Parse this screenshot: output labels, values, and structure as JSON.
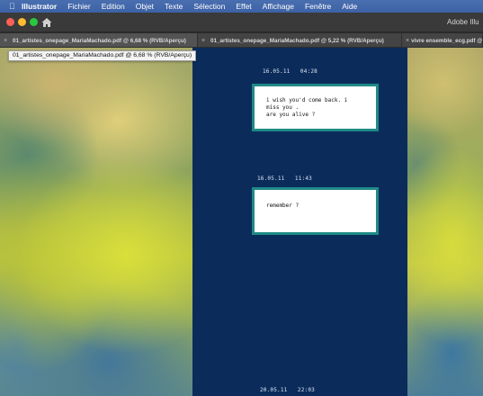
{
  "menubar": {
    "apple_icon": "apple-icon",
    "app_name": "Illustrator",
    "menus": [
      "Fichier",
      "Edition",
      "Objet",
      "Texte",
      "Sélection",
      "Effet",
      "Affichage",
      "Fenêtre",
      "Aide"
    ]
  },
  "titlebar": {
    "home_icon": "home-icon",
    "app_title": "Adobe Illu"
  },
  "tabs": [
    {
      "close": "×",
      "label": "01_artistes_onepage_MariaMachado.pdf @ 6,68 % (RVB/Aperçu)",
      "active": true
    },
    {
      "close": "×",
      "label": "01_artistes_onepage_MariaMachado.pdf @ 5,22 % (RVB/Aperçu)",
      "active": false
    },
    {
      "close": "×",
      "label": "vivre ensemble_ecg.pdf @",
      "active": false
    }
  ],
  "tooltip": "01_artistes_onepage_MariaMachado.pdf @ 6,68 % (RVB/Aperçu)",
  "document": {
    "page_color": "#0b2c5b",
    "box_border_color": "#1f8a86",
    "stamps": [
      {
        "text": "16.05.11   04:28"
      },
      {
        "text": "16.05.11   11:43"
      },
      {
        "text": "20.05.11   22:03"
      }
    ],
    "messages": [
      {
        "lines": [
          "i wish you'd come back. i",
          "miss you .",
          "are you alive ?"
        ]
      },
      {
        "lines": [
          "remember ?"
        ]
      }
    ]
  }
}
